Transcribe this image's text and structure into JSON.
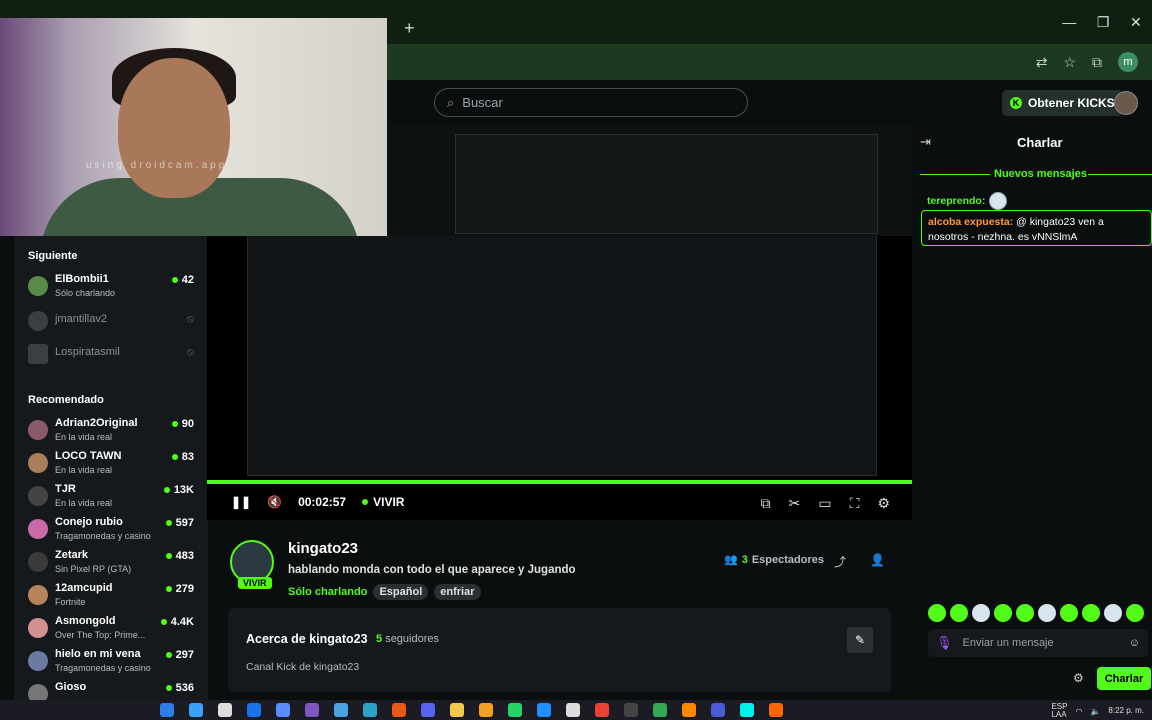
{
  "browser": {
    "new_tab_icon": "+",
    "window_controls": [
      "—",
      "❐",
      "✕"
    ],
    "profile_initial": "m",
    "extension_icons": [
      "translate-icon",
      "star-icon",
      "extensions-icon"
    ]
  },
  "header": {
    "search_placeholder": "Buscar",
    "get_kicks_label": "Obtener KICKS"
  },
  "webcam": {
    "watermark": "using droidcam.app"
  },
  "sidebar": {
    "following_title": "Siguiente",
    "following": [
      {
        "name": "ElBombii1",
        "sub": "Sólo charlando",
        "count": "42",
        "live": true
      },
      {
        "name": "jmantillav2",
        "live": false
      },
      {
        "name": "Lospiratasmil",
        "live": false
      }
    ],
    "recommended_title": "Recomendado",
    "recommended": [
      {
        "name": "Adrian2Original",
        "sub": "En la vida real",
        "count": "90",
        "color": "#8a5a6a"
      },
      {
        "name": "LOCO TAWN",
        "sub": "En la vida real",
        "count": "83",
        "color": "#a87f5a"
      },
      {
        "name": "TJR",
        "sub": "En la vida real",
        "count": "13K",
        "color": "#444"
      },
      {
        "name": "Conejo rubio",
        "sub": "Tragamonedas y casino",
        "count": "597",
        "color": "#c86aa8"
      },
      {
        "name": "Zetark",
        "sub": "Sin Pixel RP (GTA)",
        "count": "483",
        "color": "#3a3a3a"
      },
      {
        "name": "12amcupid",
        "sub": "Fortnite",
        "count": "279",
        "color": "#b6845c"
      },
      {
        "name": "Asmongold",
        "sub": "Over The Top: Prime...",
        "count": "4.4K",
        "color": "#d29090"
      },
      {
        "name": "hielo en mi vena",
        "sub": "Tragamonedas y casino",
        "count": "297",
        "color": "#6a7aa0"
      },
      {
        "name": "Gioso",
        "sub": "",
        "count": "536",
        "color": "#777"
      }
    ]
  },
  "player": {
    "time": "00:02:57",
    "live_label": "VIVIR"
  },
  "stream": {
    "streamer": "kingato23",
    "badge": "VIVIR",
    "title": "hablando monda con todo el que aparece y Jugando",
    "category": "Sólo charlando",
    "tags": [
      "Español",
      "enfriar"
    ],
    "viewer_count": "3",
    "viewer_label": "Espectadores"
  },
  "about": {
    "title": "Acerca de kingato23",
    "followers_count": "5",
    "followers_label": "seguidores",
    "description": "Canal Kick de kingato23"
  },
  "chat": {
    "title": "Charlar",
    "new_messages": "Nuevos mensajes",
    "messages": [
      {
        "user": "tereprendo:",
        "text": ""
      },
      {
        "user": "alcoba expuesta:",
        "text": "@ kingato23 ven a nosotros - nezhna. es vNNSlmA"
      }
    ],
    "input_placeholder": "Enviar un mensaje",
    "send_label": "Charlar"
  },
  "taskbar": {
    "lang": "ESP",
    "lang2": "LAA",
    "time": "8:22 p. m."
  },
  "colors": {
    "accent": "#53fc18",
    "background": "#0b0e0f",
    "panel": "#16191b"
  }
}
